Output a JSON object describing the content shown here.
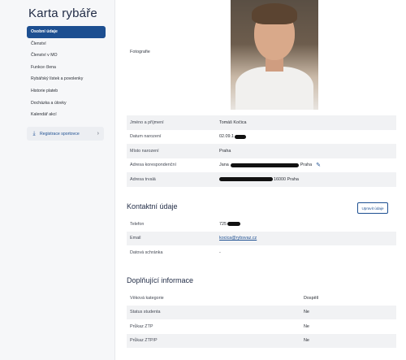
{
  "app": {
    "title": "Karta rybáře"
  },
  "sidebar": {
    "items": [
      {
        "label": "Osobní údaje",
        "active": true
      },
      {
        "label": "Členství",
        "active": false
      },
      {
        "label": "Členství v MO",
        "active": false
      },
      {
        "label": "Funkce člena",
        "active": false
      },
      {
        "label": "Rybářský lístek a povolenky",
        "active": false
      },
      {
        "label": "Historie plateb",
        "active": false
      },
      {
        "label": "Docházka a úlovky",
        "active": false
      },
      {
        "label": "Kalendář akcí",
        "active": false
      }
    ],
    "register_button": {
      "label": "Registrace sportovce",
      "icon": "download-icon",
      "chevron": "chevron-right-icon"
    }
  },
  "personal": {
    "photo_label": "Fotografie",
    "rows": [
      {
        "key": "Jméno a příjmení",
        "value": "Tomáš Kočica"
      },
      {
        "key": "Datum narození",
        "value": "02.09.1"
      },
      {
        "key": "Místo narození",
        "value": "Praha"
      },
      {
        "key": "Adresa korespondenční",
        "value_prefix": "Jana",
        "value_suffix": "Praha"
      },
      {
        "key": "Adresa trvalá",
        "value_suffix": "16000 Praha"
      }
    ]
  },
  "contact": {
    "title": "Kontaktní údaje",
    "edit_button": "Upravit údaje",
    "rows": [
      {
        "key": "Telefon",
        "value": "725"
      },
      {
        "key": "Email",
        "value": "kocica@rybsvaz.cz"
      },
      {
        "key": "Datová schránka",
        "value": "-"
      }
    ]
  },
  "extra": {
    "title": "Doplňující informace",
    "rows": [
      {
        "key": "Věková kategorie",
        "value": "Dospělí"
      },
      {
        "key": "Status studenta",
        "value": "Ne"
      },
      {
        "key": "Průkaz ZTP",
        "value": "Ne"
      },
      {
        "key": "Průkaz ZTP/P",
        "value": "Ne"
      }
    ]
  },
  "colors": {
    "accent": "#1d4f91",
    "sidebar_bg": "#f6f7f9",
    "row_shade": "#f1f2f4"
  }
}
